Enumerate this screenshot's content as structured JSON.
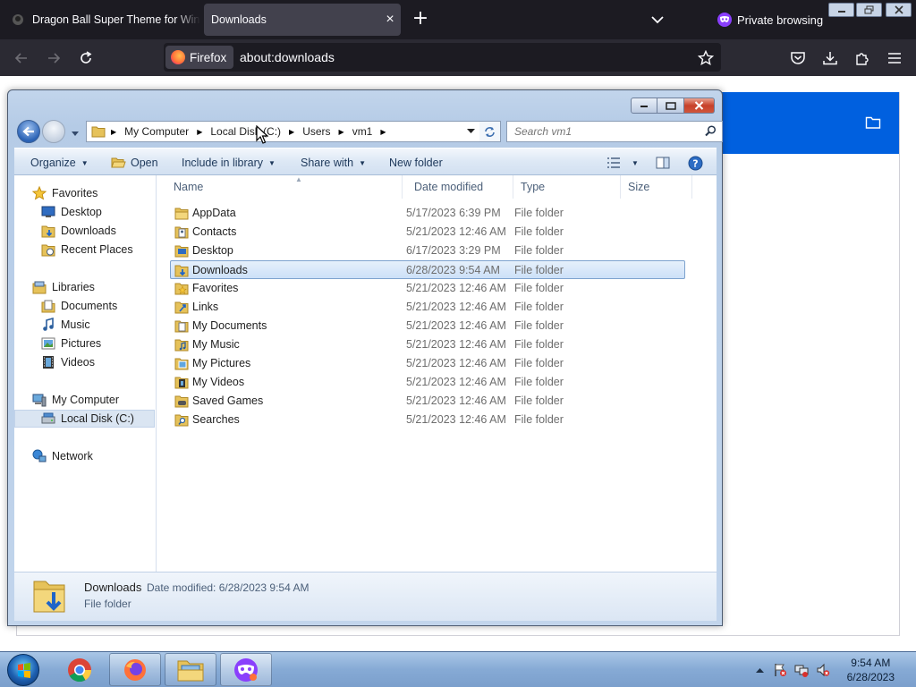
{
  "browser": {
    "tabs": [
      {
        "label": "Dragon Ball Super Theme for Windows"
      },
      {
        "label": "Downloads"
      }
    ],
    "private_label": "Private browsing",
    "identity_label": "Firefox",
    "url": "about:downloads"
  },
  "explorer": {
    "breadcrumb": [
      "My Computer",
      "Local Disk (C:)",
      "Users",
      "vm1"
    ],
    "search_placeholder": "Search vm1",
    "commands": {
      "organize": "Organize",
      "open": "Open",
      "include": "Include in library",
      "share": "Share with",
      "newfolder": "New folder"
    },
    "nav": {
      "favorites": "Favorites",
      "desktop": "Desktop",
      "downloads": "Downloads",
      "recent": "Recent Places",
      "libraries": "Libraries",
      "documents": "Documents",
      "music": "Music",
      "pictures": "Pictures",
      "videos": "Videos",
      "computer": "My Computer",
      "localdisk": "Local Disk (C:)",
      "network": "Network"
    },
    "columns": {
      "name": "Name",
      "date": "Date modified",
      "type": "Type",
      "size": "Size"
    },
    "rows": [
      {
        "name": "AppData",
        "date": "5/17/2023 6:39 PM",
        "type": "File folder"
      },
      {
        "name": "Contacts",
        "date": "5/21/2023 12:46 AM",
        "type": "File folder"
      },
      {
        "name": "Desktop",
        "date": "6/17/2023 3:29 PM",
        "type": "File folder"
      },
      {
        "name": "Downloads",
        "date": "6/28/2023 9:54 AM",
        "type": "File folder"
      },
      {
        "name": "Favorites",
        "date": "5/21/2023 12:46 AM",
        "type": "File folder"
      },
      {
        "name": "Links",
        "date": "5/21/2023 12:46 AM",
        "type": "File folder"
      },
      {
        "name": "My Documents",
        "date": "5/21/2023 12:46 AM",
        "type": "File folder"
      },
      {
        "name": "My Music",
        "date": "5/21/2023 12:46 AM",
        "type": "File folder"
      },
      {
        "name": "My Pictures",
        "date": "5/21/2023 12:46 AM",
        "type": "File folder"
      },
      {
        "name": "My Videos",
        "date": "5/21/2023 12:46 AM",
        "type": "File folder"
      },
      {
        "name": "Saved Games",
        "date": "5/21/2023 12:46 AM",
        "type": "File folder"
      },
      {
        "name": "Searches",
        "date": "5/21/2023 12:46 AM",
        "type": "File folder"
      }
    ],
    "details": {
      "name": "Downloads",
      "modified": "Date modified: 6/28/2023 9:54 AM",
      "type": "File folder"
    }
  },
  "taskbar": {
    "time": "9:54 AM",
    "date": "6/28/2023"
  },
  "colors": {
    "firefox_dark": "#1c1b22",
    "page_accent": "#0060df",
    "selection": "#cce0f8"
  }
}
